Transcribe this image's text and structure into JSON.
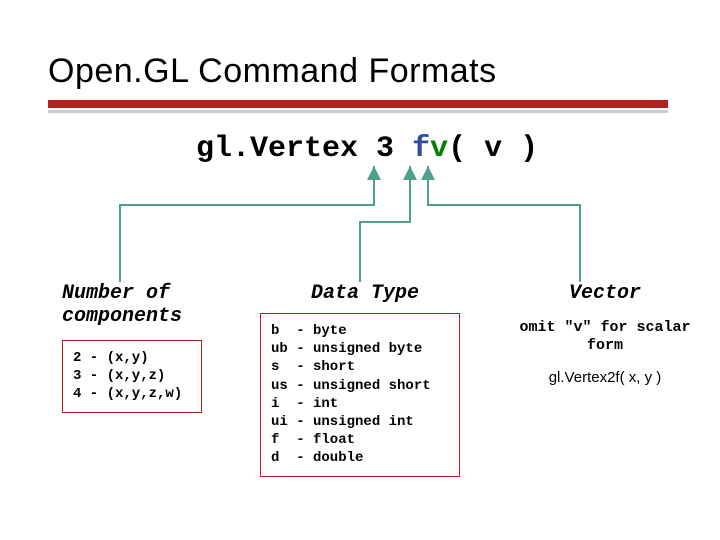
{
  "title": "Open.GL Command Formats",
  "command": {
    "prefix": "gl.Vertex",
    "count": "3",
    "type": "f",
    "vec": "v",
    "args": "( v )"
  },
  "numberOfComponents": {
    "heading": "Number of\ncomponents",
    "lines": "2 - (x,y)\n3 - (x,y,z)\n4 - (x,y,z,w)"
  },
  "dataType": {
    "heading": "Data Type",
    "lines": "b  - byte\nub - unsigned byte\ns  - short\nus - unsigned short\ni  - int\nui - unsigned int\nf  - float\nd  - double"
  },
  "vector": {
    "heading": "Vector",
    "note": "omit \"v\" for\nscalar form",
    "example": "gl.Vertex2f( x, y )"
  }
}
